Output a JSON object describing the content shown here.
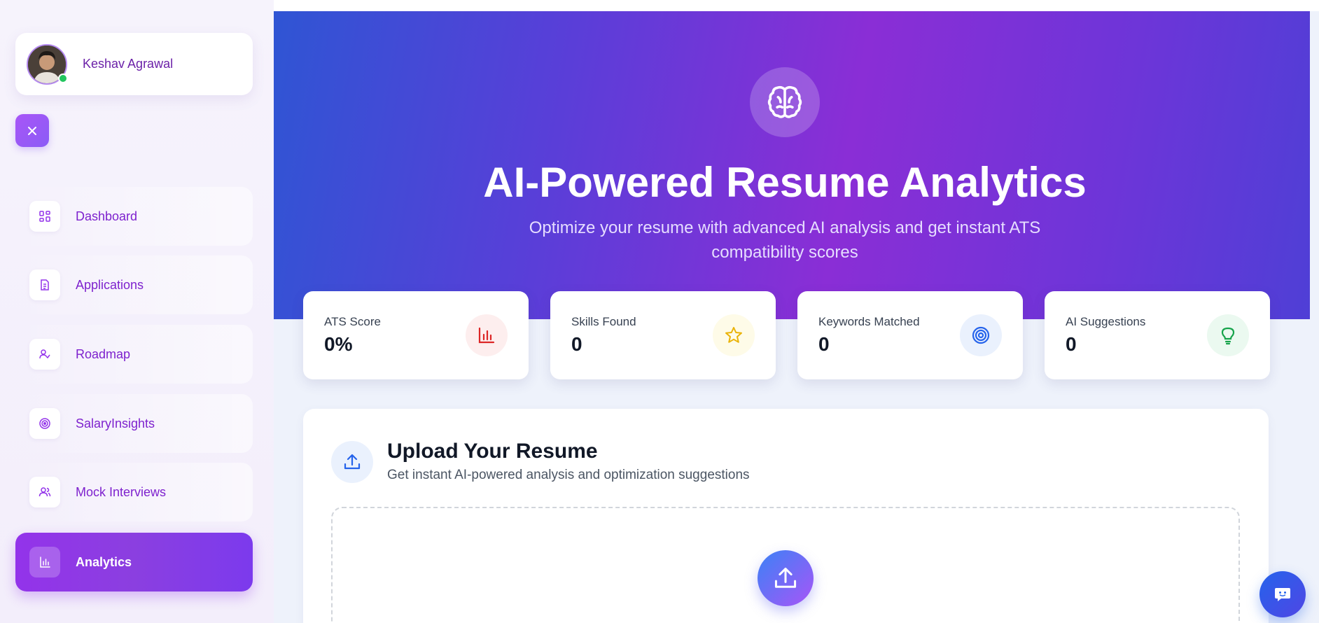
{
  "user": {
    "name": "Keshav Agrawal",
    "status": "online"
  },
  "sidebar": {
    "close_icon": "x-icon",
    "items": [
      {
        "label": "Dashboard",
        "icon": "grid-icon",
        "active": false
      },
      {
        "label": "Applications",
        "icon": "document-icon",
        "active": false
      },
      {
        "label": "Roadmap",
        "icon": "user-check-icon",
        "active": false
      },
      {
        "label": "SalaryInsights",
        "icon": "target-icon",
        "active": false
      },
      {
        "label": "Mock Interviews",
        "icon": "users-icon",
        "active": false
      },
      {
        "label": "Analytics",
        "icon": "bar-chart-icon",
        "active": true
      }
    ]
  },
  "hero": {
    "icon": "brain-icon",
    "title": "AI-Powered Resume Analytics",
    "subtitle": "Optimize your resume with advanced AI analysis and get instant ATS compatibility scores"
  },
  "stats": [
    {
      "label": "ATS Score",
      "value": "0%",
      "icon": "bar-chart-icon",
      "color": "#dc2626",
      "bg": "#fdeeee"
    },
    {
      "label": "Skills Found",
      "value": "0",
      "icon": "star-icon",
      "color": "#eab308",
      "bg": "#fefbe8"
    },
    {
      "label": "Keywords Matched",
      "value": "0",
      "icon": "target-icon",
      "color": "#2563eb",
      "bg": "#eaf1fd"
    },
    {
      "label": "AI Suggestions",
      "value": "0",
      "icon": "lightbulb-icon",
      "color": "#16a34a",
      "bg": "#ebf9f0"
    }
  ],
  "upload": {
    "icon": "upload-icon",
    "title": "Upload Your Resume",
    "subtitle": "Get instant AI-powered analysis and optimization suggestions"
  },
  "chat": {
    "icon": "chat-bot-icon"
  },
  "colors": {
    "accent": "#9333ea",
    "hero_start": "#2f55d4",
    "hero_mid": "#8a2ed6"
  }
}
